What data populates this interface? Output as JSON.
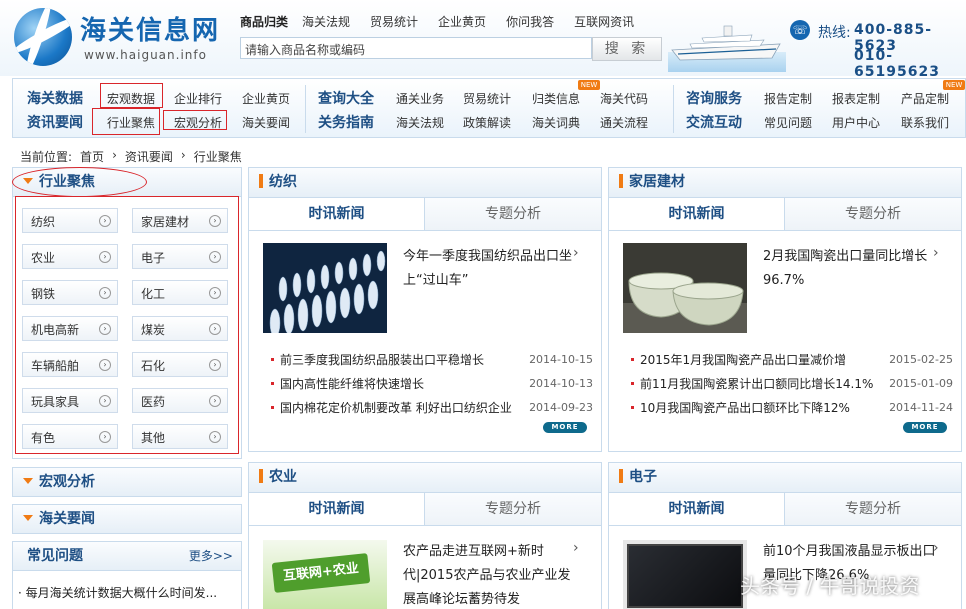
{
  "logo": {
    "name": "海关信息网",
    "url": "www.haiguan.info"
  },
  "top_nav": [
    "商品归类",
    "海关法规",
    "贸易统计",
    "企业黄页",
    "你问我答",
    "互联网资讯"
  ],
  "search": {
    "placeholder": "请输入商品名称或编码",
    "button": "搜 索"
  },
  "hotline": {
    "label": "热线:",
    "num1": "400-885-5623",
    "num2": "010-65195623"
  },
  "nav_row1": {
    "group1": "海关数据",
    "items1": [
      "宏观数据",
      "企业排行",
      "企业黄页"
    ],
    "group2": "查询大全",
    "items2": [
      "通关业务",
      "贸易统计",
      "归类信息",
      "海关代码"
    ],
    "group3": "咨询服务",
    "items3": [
      "报告定制",
      "报表定制",
      "产品定制"
    ]
  },
  "nav_row2": {
    "group1": "资讯要闻",
    "items1": [
      "行业聚焦",
      "宏观分析",
      "海关要闻"
    ],
    "group2": "关务指南",
    "items2": [
      "海关法规",
      "政策解读",
      "海关词典",
      "通关流程"
    ],
    "group3": "交流互动",
    "items3": [
      "常见问题",
      "用户中心",
      "联系我们"
    ]
  },
  "badge": "NEW",
  "breadcrumb": {
    "prefix": "当前位置:",
    "items": [
      "首页",
      "资讯要闻",
      "行业聚焦"
    ],
    "sep": "›"
  },
  "sidebar": {
    "focus_title": "行业聚焦",
    "categories": [
      "纺织",
      "家居建材",
      "农业",
      "电子",
      "钢铁",
      "化工",
      "机电高新",
      "煤炭",
      "车辆船舶",
      "石化",
      "玩具家具",
      "医药",
      "有色",
      "其他"
    ],
    "macro_title": "宏观分析",
    "news_title": "海关要闻",
    "faq_title": "常见问题",
    "faq_more": "更多>>",
    "faq_items": [
      "每月海关统计数据大概什么时间发..."
    ]
  },
  "panels": [
    {
      "title": "纺织",
      "tabs": [
        "时讯新闻",
        "专题分析"
      ],
      "feature": "今年一季度我国纺织品出口坐上“过山车”",
      "news": [
        {
          "t": "前三季度我国纺织品服装出口平稳增长",
          "d": "2014-10-15"
        },
        {
          "t": "国内高性能纤维将快速增长",
          "d": "2014-10-13"
        },
        {
          "t": "国内棉花定价机制要改革 利好出口纺织企业",
          "d": "2014-09-23"
        }
      ],
      "more": "MORE"
    },
    {
      "title": "家居建材",
      "tabs": [
        "时讯新闻",
        "专题分析"
      ],
      "feature": "2月我国陶瓷出口量同比增长96.7%",
      "news": [
        {
          "t": "2015年1月我国陶瓷产品出口量减价增",
          "d": "2015-02-25"
        },
        {
          "t": "前11月我国陶瓷累计出口额同比增长14.1%",
          "d": "2015-01-09"
        },
        {
          "t": "10月我国陶瓷产品出口额环比下降12%",
          "d": "2014-11-24"
        }
      ],
      "more": "MORE"
    },
    {
      "title": "农业",
      "tabs": [
        "时讯新闻",
        "专题分析"
      ],
      "feature": "农产品走进互联网+新时代|2015农产品与农业产业发展高峰论坛蓄势待发",
      "thumb_text": "互联网+农业"
    },
    {
      "title": "电子",
      "tabs": [
        "时讯新闻",
        "专题分析"
      ],
      "feature": "前10个月我国液晶显示板出口量同比下降26.6%"
    }
  ],
  "watermark": "头条号 / 牛哥说投资"
}
